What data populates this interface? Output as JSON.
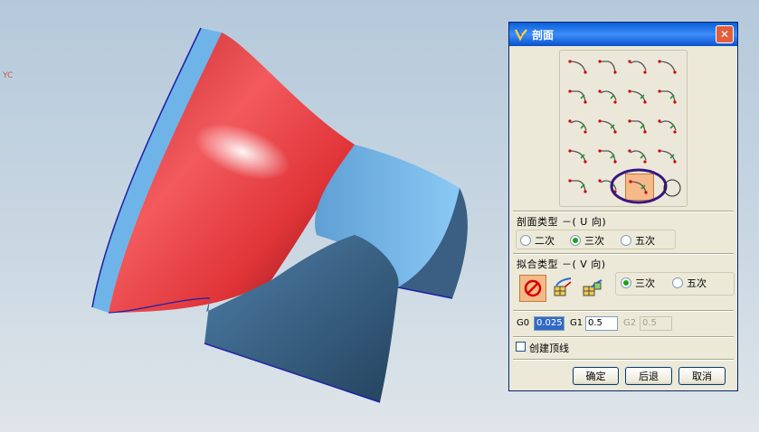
{
  "viewport": {
    "axis_label": "YC"
  },
  "dialog": {
    "title": "剖面",
    "close_symbol": "✕",
    "section_u": {
      "title": "剖面类型 －( U 向)",
      "options": [
        "二次",
        "三次",
        "五次"
      ],
      "selected": "三次"
    },
    "section_v": {
      "title": "拟合类型 －( V 向)",
      "options": [
        "三次",
        "五次"
      ],
      "selected": "三次"
    },
    "continuity": {
      "g0_label": "G0",
      "g0_value": "0.025",
      "g1_label": "G1",
      "g1_value": "0.5",
      "g2_label": "G2",
      "g2_value": "0.5"
    },
    "apex_checkbox": {
      "label": "创建顶线",
      "checked": false
    },
    "buttons": {
      "ok": "确定",
      "back": "后退",
      "cancel": "取消"
    }
  }
}
